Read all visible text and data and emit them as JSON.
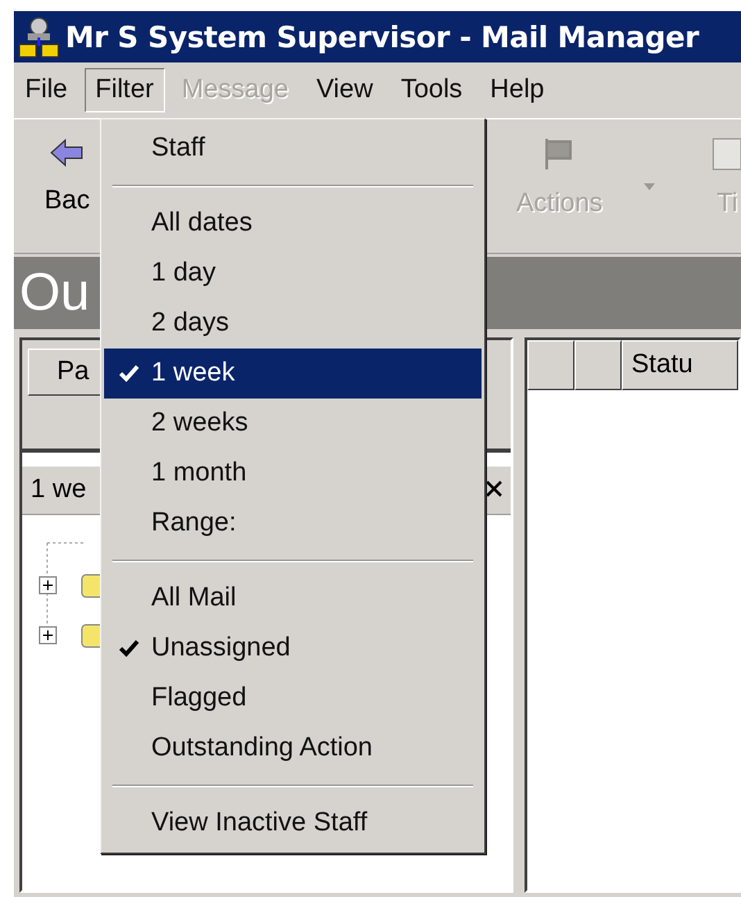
{
  "window": {
    "title": "Mr S System Supervisor - Mail Manager"
  },
  "menu_bar": [
    {
      "label": "File",
      "selected": false,
      "disabled": false
    },
    {
      "label": "Filter",
      "selected": true,
      "disabled": false
    },
    {
      "label": "Message",
      "selected": false,
      "disabled": true
    },
    {
      "label": "View",
      "selected": false,
      "disabled": false
    },
    {
      "label": "Tools",
      "selected": false,
      "disabled": false
    },
    {
      "label": "Help",
      "selected": false,
      "disabled": false
    }
  ],
  "toolbar": [
    {
      "label": "Bac",
      "kind": "back",
      "disabled": false
    },
    {
      "label": "Actions",
      "kind": "flag",
      "disabled": true
    },
    {
      "label": "Ti",
      "kind": "box",
      "disabled": true
    }
  ],
  "header": {
    "title": "Ou"
  },
  "left_pane": {
    "column_header": "Pa",
    "filter_label": "1 we",
    "tree": [
      {
        "expanded": false
      },
      {
        "expanded": false
      }
    ]
  },
  "right_pane": {
    "column_3": "Statu"
  },
  "filter_menu": {
    "items": [
      {
        "kind": "item",
        "label": "Staff",
        "checked": false,
        "selected": false
      },
      {
        "kind": "separator"
      },
      {
        "kind": "item",
        "label": "All dates",
        "checked": false,
        "selected": false
      },
      {
        "kind": "item",
        "label": "1 day",
        "checked": false,
        "selected": false
      },
      {
        "kind": "item",
        "label": "2 days",
        "checked": false,
        "selected": false
      },
      {
        "kind": "item",
        "label": "1 week",
        "checked": true,
        "selected": true
      },
      {
        "kind": "item",
        "label": "2 weeks",
        "checked": false,
        "selected": false
      },
      {
        "kind": "item",
        "label": "1 month",
        "checked": false,
        "selected": false
      },
      {
        "kind": "item",
        "label": "Range:",
        "checked": false,
        "selected": false
      },
      {
        "kind": "separator"
      },
      {
        "kind": "item",
        "label": "All Mail",
        "checked": false,
        "selected": false
      },
      {
        "kind": "item",
        "label": "Unassigned",
        "checked": true,
        "selected": false
      },
      {
        "kind": "item",
        "label": "Flagged",
        "checked": false,
        "selected": false
      },
      {
        "kind": "item",
        "label": "Outstanding Action",
        "checked": false,
        "selected": false
      },
      {
        "kind": "separator"
      },
      {
        "kind": "item",
        "label": "View Inactive Staff",
        "checked": false,
        "selected": false
      }
    ]
  }
}
